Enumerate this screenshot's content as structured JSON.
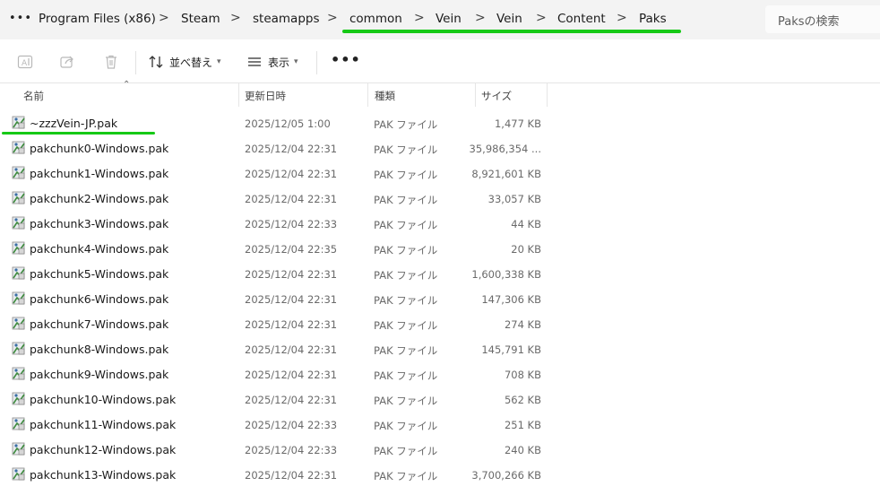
{
  "breadcrumb": {
    "items": [
      "Program Files (x86)",
      "Steam",
      "steamapps",
      "common",
      "Vein",
      "Vein",
      "Content",
      "Paks"
    ],
    "separator": ">"
  },
  "search": {
    "placeholder": "Paksの検索"
  },
  "toolbar": {
    "sort_label": "並べ替え",
    "view_label": "表示",
    "more_label": "•••"
  },
  "columns": {
    "name": "名前",
    "date": "更新日時",
    "type": "種類",
    "size": "サイズ"
  },
  "files": [
    {
      "name": "~zzzVein-JP.pak",
      "date": "2025/12/05 1:00",
      "type": "PAK ファイル",
      "size": "1,477 KB"
    },
    {
      "name": "pakchunk0-Windows.pak",
      "date": "2025/12/04 22:31",
      "type": "PAK ファイル",
      "size": "35,986,354 ..."
    },
    {
      "name": "pakchunk1-Windows.pak",
      "date": "2025/12/04 22:31",
      "type": "PAK ファイル",
      "size": "8,921,601 KB"
    },
    {
      "name": "pakchunk2-Windows.pak",
      "date": "2025/12/04 22:31",
      "type": "PAK ファイル",
      "size": "33,057 KB"
    },
    {
      "name": "pakchunk3-Windows.pak",
      "date": "2025/12/04 22:33",
      "type": "PAK ファイル",
      "size": "44 KB"
    },
    {
      "name": "pakchunk4-Windows.pak",
      "date": "2025/12/04 22:35",
      "type": "PAK ファイル",
      "size": "20 KB"
    },
    {
      "name": "pakchunk5-Windows.pak",
      "date": "2025/12/04 22:31",
      "type": "PAK ファイル",
      "size": "1,600,338 KB"
    },
    {
      "name": "pakchunk6-Windows.pak",
      "date": "2025/12/04 22:31",
      "type": "PAK ファイル",
      "size": "147,306 KB"
    },
    {
      "name": "pakchunk7-Windows.pak",
      "date": "2025/12/04 22:31",
      "type": "PAK ファイル",
      "size": "274 KB"
    },
    {
      "name": "pakchunk8-Windows.pak",
      "date": "2025/12/04 22:31",
      "type": "PAK ファイル",
      "size": "145,791 KB"
    },
    {
      "name": "pakchunk9-Windows.pak",
      "date": "2025/12/04 22:31",
      "type": "PAK ファイル",
      "size": "708 KB"
    },
    {
      "name": "pakchunk10-Windows.pak",
      "date": "2025/12/04 22:31",
      "type": "PAK ファイル",
      "size": "562 KB"
    },
    {
      "name": "pakchunk11-Windows.pak",
      "date": "2025/12/04 22:33",
      "type": "PAK ファイル",
      "size": "251 KB"
    },
    {
      "name": "pakchunk12-Windows.pak",
      "date": "2025/12/04 22:33",
      "type": "PAK ファイル",
      "size": "240 KB"
    },
    {
      "name": "pakchunk13-Windows.pak",
      "date": "2025/12/04 22:31",
      "type": "PAK ファイル",
      "size": "3,700,266 KB"
    }
  ],
  "colors": {
    "highlight": "#16c916",
    "address_bar_bg": "#f3f3f3"
  }
}
